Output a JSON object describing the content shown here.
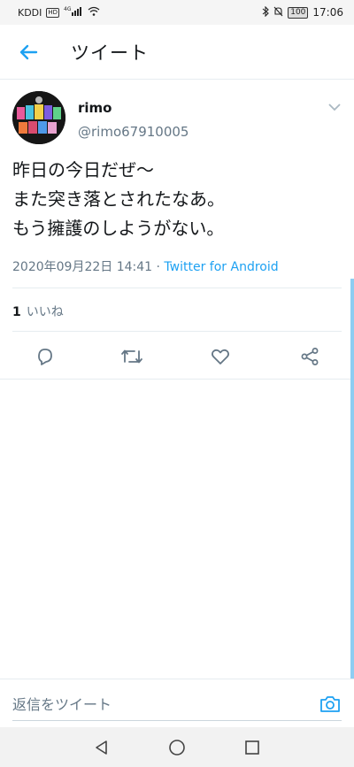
{
  "status_bar": {
    "carrier": "KDDI",
    "hd": "HD",
    "network": "4G",
    "battery": "100",
    "time": "17:06"
  },
  "header": {
    "title": "ツイート"
  },
  "tweet": {
    "display_name": "rimo",
    "handle": "@rimo67910005",
    "text": "昨日の今日だぜ〜\nまた突き落とされたなあ。\nもう擁護のしようがない。",
    "timestamp": "2020年09月22日 14:41",
    "separator": " · ",
    "client": "Twitter for Android",
    "like_count": "1",
    "like_label": "いいね"
  },
  "actions": {
    "reply": "reply-icon",
    "retweet": "retweet-icon",
    "like": "heart-icon",
    "share": "share-icon"
  },
  "reply_bar": {
    "placeholder": "返信をツイート"
  },
  "colors": {
    "accent": "#1da1f2",
    "secondary_text": "#657786",
    "divider": "#e6ecf0"
  }
}
